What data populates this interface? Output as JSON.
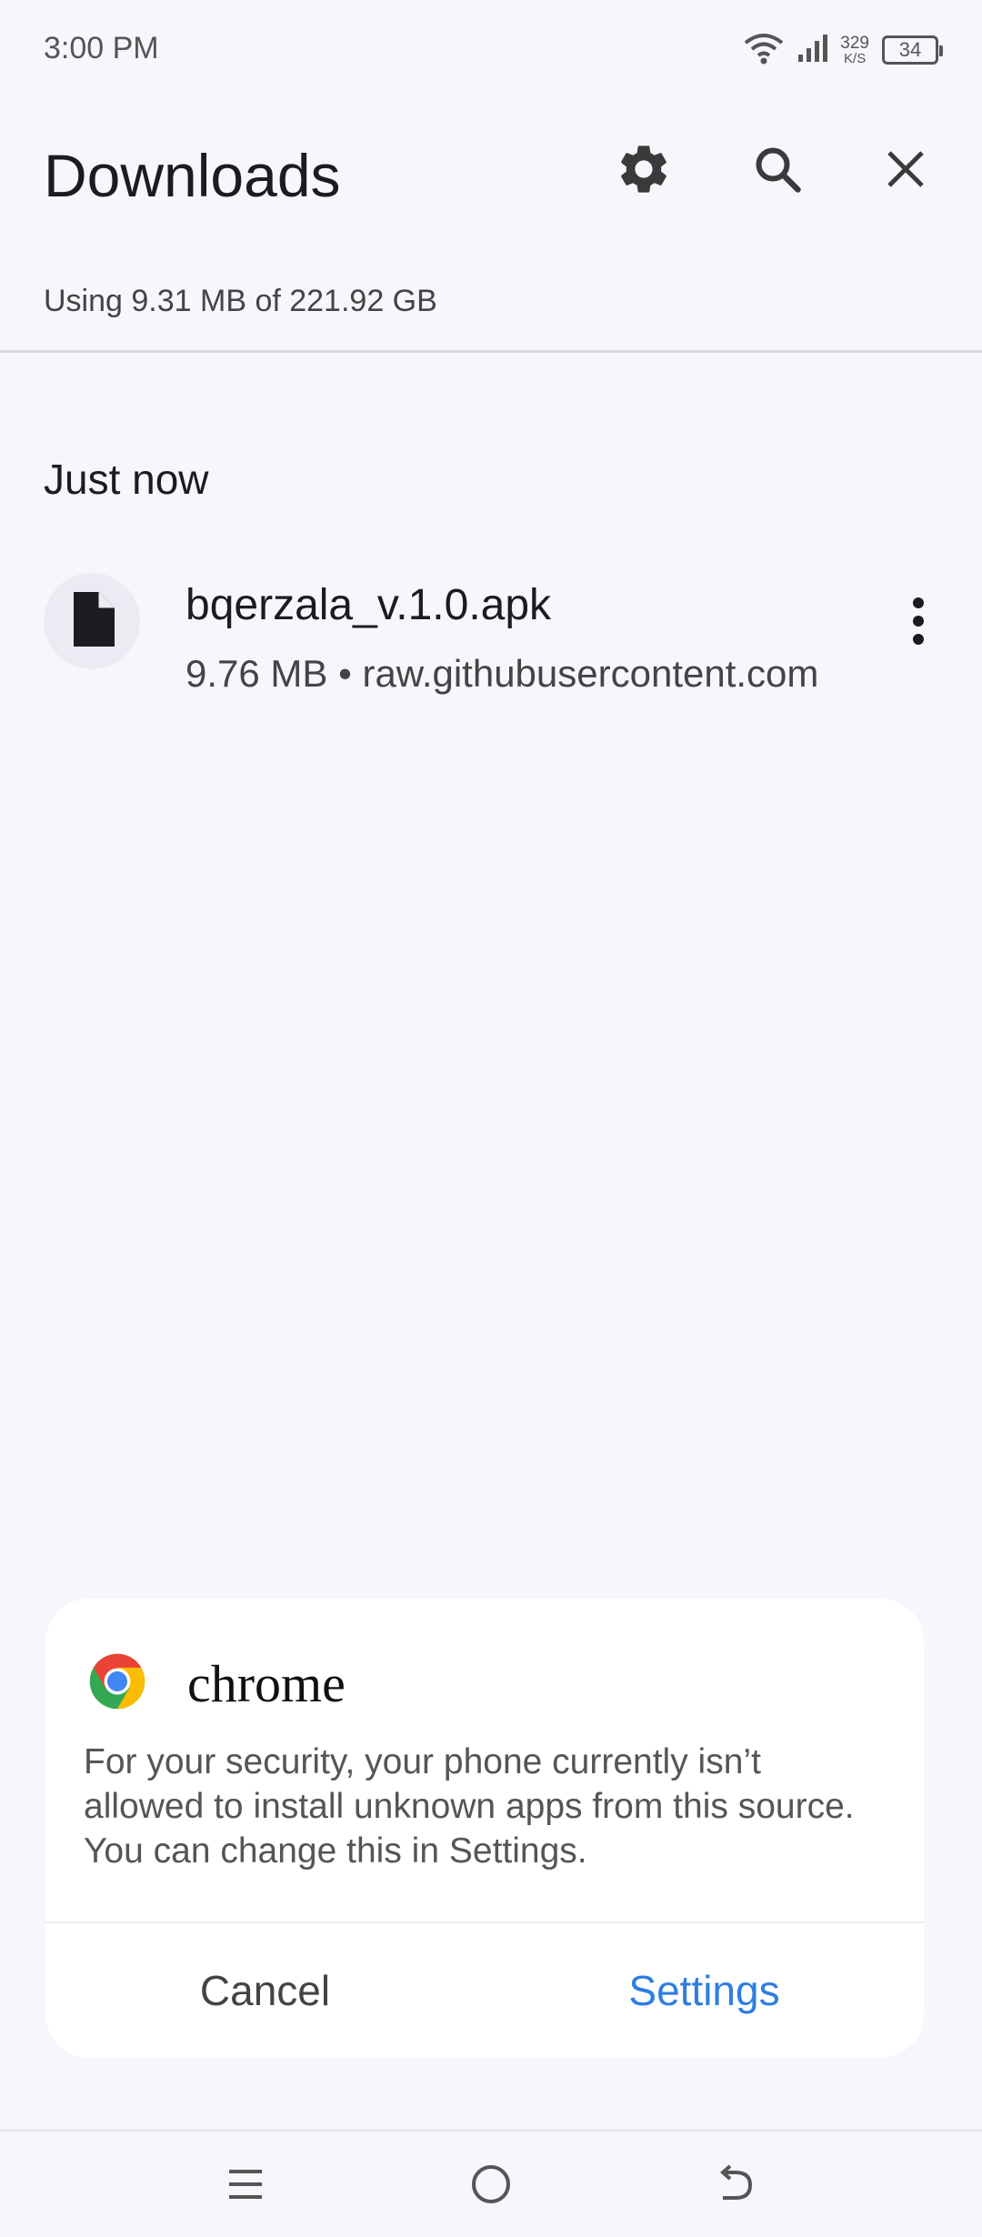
{
  "status_bar": {
    "time": "3:00 PM",
    "net_speed": "329",
    "net_unit": "K/S",
    "battery": "34"
  },
  "header": {
    "title": "Downloads"
  },
  "storage_info": "Using 9.31 MB of 221.92 GB",
  "section": {
    "label": "Just now"
  },
  "downloads": [
    {
      "name": "bqerzala_v.1.0.apk",
      "meta": "9.76 MB • raw.githubusercontent.com"
    }
  ],
  "dialog": {
    "app_name": "chrome",
    "message": "For your security, your phone currently isn’t allowed to install unknown apps from this source. You can change this in Settings.",
    "cancel_label": "Cancel",
    "settings_label": "Settings"
  },
  "colors": {
    "accent": "#2f7de1",
    "background": "#f7f6fc"
  }
}
